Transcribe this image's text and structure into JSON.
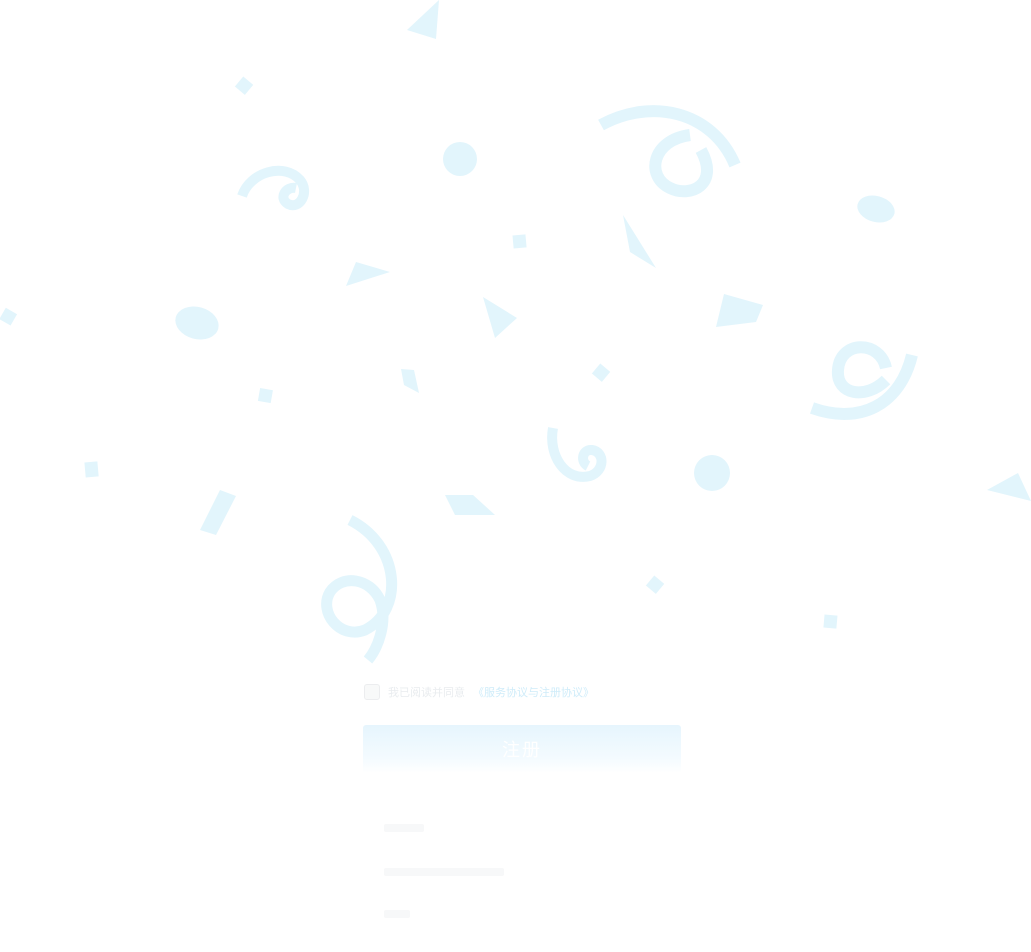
{
  "agreement": {
    "checkbox_label": "我已阅读并同意",
    "link_label": "《服务协议与注册协议》"
  },
  "register_button": {
    "label": "注册"
  },
  "colors": {
    "confetti": "#e2f5fc",
    "button_top": "#e6f5fd",
    "link": "#bfe6f8"
  }
}
